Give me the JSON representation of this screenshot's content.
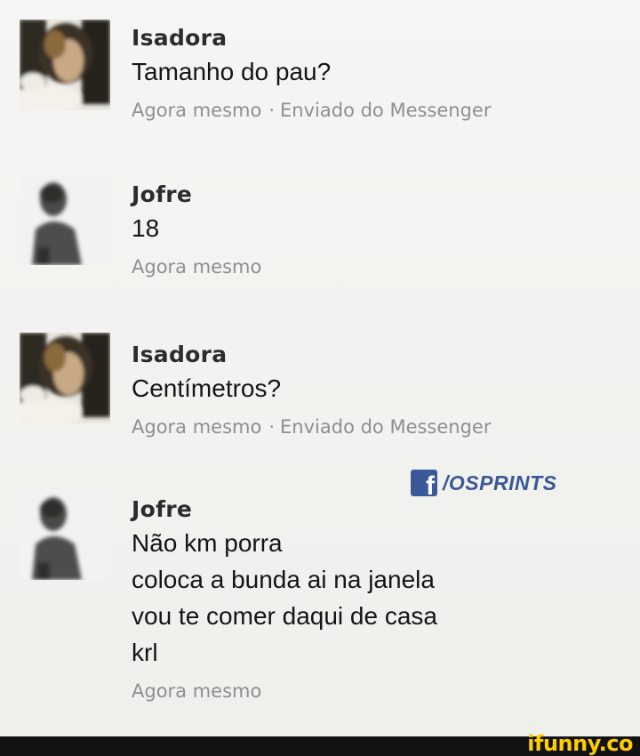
{
  "comments": [
    {
      "author": "Isadora",
      "lines": [
        "Tamanho do pau?"
      ],
      "time": "Agora mesmo",
      "separator": "·",
      "source": "Enviado do Messenger",
      "avatar": "woman-photo-avatar"
    },
    {
      "author": "Jofre",
      "lines": [
        "18"
      ],
      "time": "Agora mesmo",
      "avatar": "man-photo-avatar"
    },
    {
      "author": "Isadora",
      "lines": [
        "Centímetros?"
      ],
      "time": "Agora mesmo",
      "separator": "·",
      "source": "Enviado do Messenger",
      "avatar": "woman-photo-avatar"
    },
    {
      "author": "Jofre",
      "lines": [
        "Não km porra",
        "coloca a bunda ai na janela",
        "vou te comer daqui de casa",
        "krl"
      ],
      "time": "Agora mesmo",
      "avatar": "man-photo-avatar"
    }
  ],
  "watermark": {
    "icon": "facebook-icon",
    "icon_letter": "f",
    "text": "/OSPRINTS",
    "color": "#3b5998"
  },
  "footer": {
    "brand": "ifunny.co",
    "brand_color": "#ffcc00"
  }
}
